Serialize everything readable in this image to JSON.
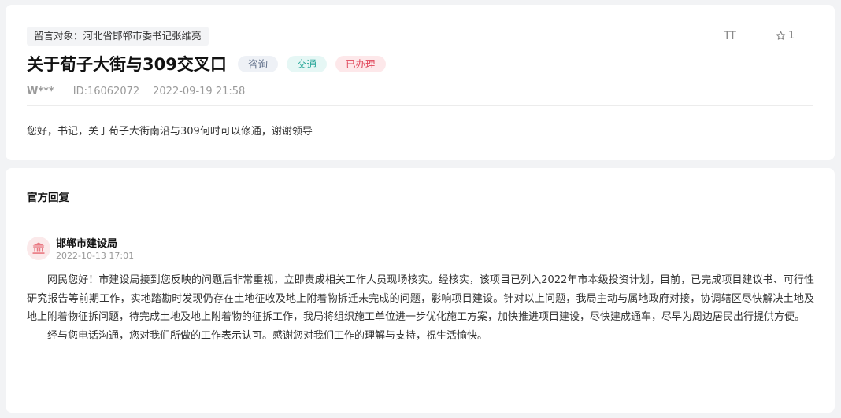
{
  "message": {
    "target_label": "留言对象：河北省邯郸市委书记张维亮",
    "title": "关于荀子大街与309交叉口",
    "tags": [
      "咨询",
      "交通",
      "已办理"
    ],
    "user": "W***",
    "id_text": "ID:16062072",
    "datetime": "2022-09-19 21:58",
    "body": "您好，书记，关于荀子大街南沿与309何时可以修通，谢谢领导",
    "font_size_label": "TT",
    "star_count": "1"
  },
  "reply": {
    "heading": "官方回复",
    "department": "邯郸市建设局",
    "datetime": "2022-10-13 17:01",
    "paragraphs": [
      "网民您好！市建设局接到您反映的问题后非常重视，立即责成相关工作人员现场核实。经核实，该项目已列入2022年市本级投资计划，目前，已完成项目建议书、可行性研究报告等前期工作，实地踏勘时发现仍存在土地征收及地上附着物拆迁未完成的问题，影响项目建设。针对以上问题，我局主动与属地政府对接，协调辖区尽快解决土地及地上附着物征拆问题，待完成土地及地上附着物的征拆工作，我局将组织施工单位进一步优化施工方案，加快推进项目建设，尽快建成通车，尽早为周边居民出行提供方便。",
      "经与您电话沟通，您对我们所做的工作表示认可。感谢您对我们工作的理解与支持，祝生活愉快。"
    ]
  },
  "colors": {
    "tag_consult": "#5b6b86",
    "tag_traffic": "#2ba89a",
    "tag_done": "#e0485c",
    "avatar_icon": "#e97a83"
  },
  "icons": [
    "font-size-icon",
    "star-icon",
    "government-building-icon"
  ]
}
